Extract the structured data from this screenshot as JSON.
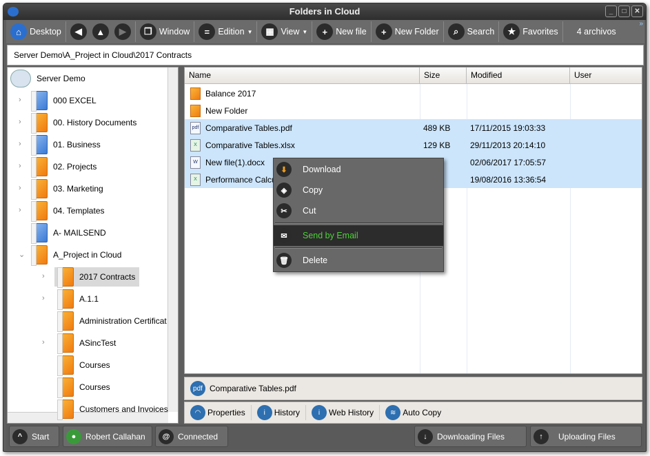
{
  "window": {
    "title": "Folders in Cloud",
    "controls": [
      "_",
      "□",
      "✕"
    ]
  },
  "toolbar": {
    "desktop": "Desktop",
    "window": "Window",
    "edition": "Edition",
    "view": "View",
    "new_file": "New file",
    "new_folder": "New Folder",
    "search": "Search",
    "favorites": "Favorites",
    "count": "4 archivos"
  },
  "address": {
    "path": "Server Demo\\A_Project in Cloud\\2017 Contracts"
  },
  "tree": {
    "root": "Server Demo",
    "items": [
      {
        "label": "000 EXCEL",
        "color": "blue",
        "expandable": true
      },
      {
        "label": "00. History Documents",
        "color": "orange",
        "expandable": true
      },
      {
        "label": "01. Business",
        "color": "blue",
        "expandable": true
      },
      {
        "label": "02. Projects",
        "color": "orange",
        "expandable": true
      },
      {
        "label": "03. Marketing",
        "color": "orange",
        "expandable": true
      },
      {
        "label": "04. Templates",
        "color": "orange",
        "expandable": true
      },
      {
        "label": "A- MAILSEND",
        "color": "blue",
        "expandable": false
      },
      {
        "label": "A_Project in Cloud",
        "color": "orange",
        "expanded": true
      }
    ],
    "children": [
      {
        "label": "2017 Contracts",
        "selected": true,
        "expandable": true
      },
      {
        "label": "A.1.1",
        "expandable": true
      },
      {
        "label": "Administration Certificat",
        "expandable": false
      },
      {
        "label": "ASincTest",
        "expandable": true
      },
      {
        "label": "Courses",
        "expandable": false
      },
      {
        "label": "Courses",
        "expandable": false
      },
      {
        "label": "Customers and Invoices",
        "expandable": false
      }
    ]
  },
  "files": {
    "columns": [
      "Name",
      "Size",
      "Modified",
      "User"
    ],
    "rows": [
      {
        "name": "Balance 2017",
        "type": "folder",
        "size": "",
        "modified": ""
      },
      {
        "name": "New Folder",
        "type": "folder",
        "size": "",
        "modified": ""
      },
      {
        "name": "Comparative Tables.pdf",
        "type": "pdf",
        "size": "489 KB",
        "modified": "17/11/2015 19:03:33",
        "selected": true
      },
      {
        "name": "Comparative Tables.xlsx",
        "type": "xlsx",
        "size": "129 KB",
        "modified": "29/11/2013 20:14:10",
        "selected": true
      },
      {
        "name": "New file(1).docx",
        "type": "docx",
        "size": "",
        "modified": "02/06/2017 17:05:57",
        "selected": true
      },
      {
        "name": "Performance Calcu",
        "type": "xlsx",
        "size": "",
        "modified": "19/08/2016 13:36:54",
        "selected": true
      }
    ]
  },
  "context_menu": {
    "items": [
      "Download",
      "Copy",
      "Cut",
      "Send by Email",
      "Delete"
    ],
    "highlight_color": "#4fd13a"
  },
  "details": {
    "filename": "Comparative Tables.pdf"
  },
  "tabs": [
    "Properties",
    "History",
    "Web History",
    "Auto Copy"
  ],
  "status": {
    "start": "Start",
    "user": "Robert Callahan",
    "connection": "Connected",
    "downloading": "Downloading Files",
    "uploading": "Uploading Files"
  }
}
